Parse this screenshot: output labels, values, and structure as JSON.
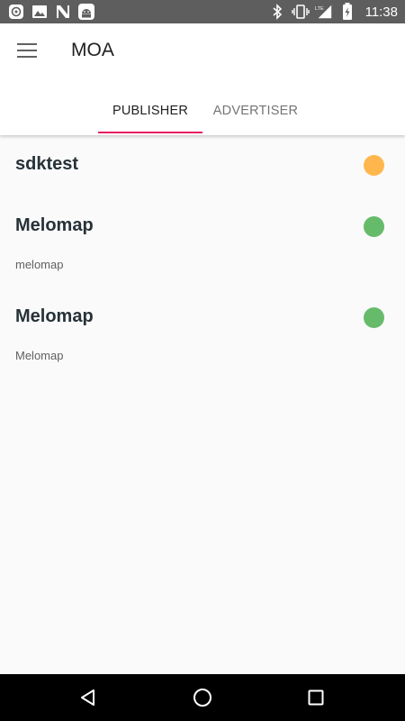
{
  "status_bar": {
    "time": "11:38",
    "network": "LTE",
    "left_icons": [
      "notification-app-icon",
      "image-icon",
      "n-icon",
      "android-debug-icon"
    ],
    "right_icons": [
      "bluetooth-icon",
      "vibrate-icon",
      "signal-lte-icon",
      "battery-charging-icon"
    ]
  },
  "app_bar": {
    "title": "MOA",
    "menu_icon": "hamburger-menu-icon"
  },
  "tabs": [
    {
      "label": "PUBLISHER",
      "selected": true
    },
    {
      "label": "ADVERTISER",
      "selected": false
    }
  ],
  "colors": {
    "tab_indicator": "#e91e63",
    "status_pending": "#ffb74d",
    "status_active": "#66bb6a"
  },
  "items": [
    {
      "title": "sdktest",
      "subtitle": "",
      "status": "pending",
      "status_color": "#ffb74d"
    },
    {
      "title": "Melomap",
      "subtitle": "melomap",
      "status": "active",
      "status_color": "#66bb6a"
    },
    {
      "title": "Melomap",
      "subtitle": "Melomap",
      "status": "active",
      "status_color": "#66bb6a"
    }
  ],
  "nav_bar": {
    "back": "back-triangle-icon",
    "home": "home-circle-icon",
    "recents": "recents-square-icon"
  }
}
